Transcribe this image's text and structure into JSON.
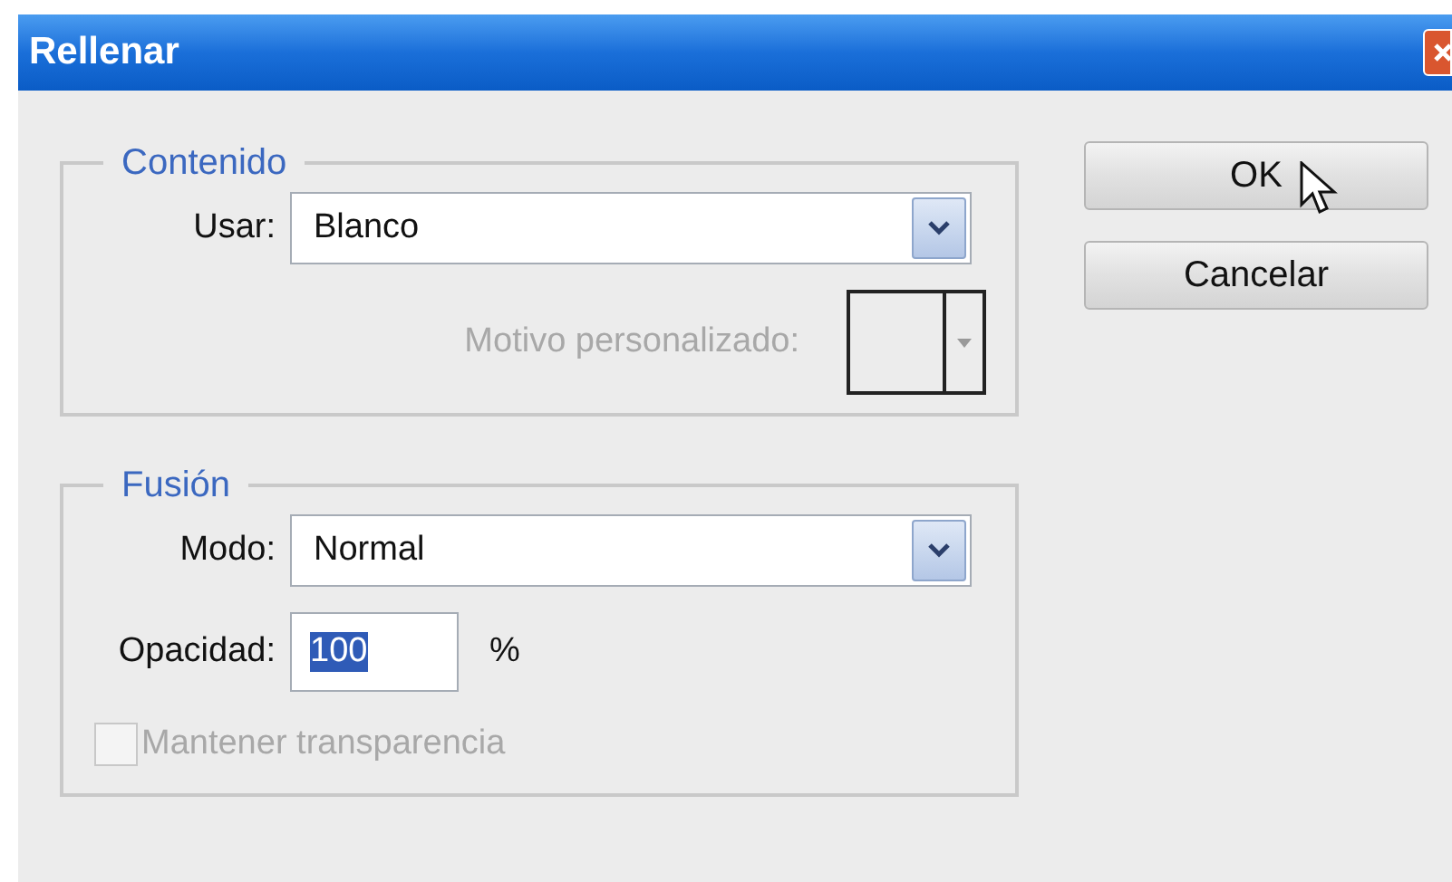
{
  "window": {
    "title": "Rellenar"
  },
  "groups": [
    {
      "title": "Contenido",
      "rows": [
        {
          "kind": "select",
          "label": "Usar:",
          "value": "Blanco",
          "disabled": false
        },
        {
          "kind": "swatch",
          "label": "Motivo personalizado:",
          "disabled": true
        }
      ]
    },
    {
      "title": "Fusión",
      "rows": [
        {
          "kind": "select",
          "label": "Modo:",
          "value": "Normal",
          "disabled": false
        },
        {
          "kind": "number",
          "label": "Opacidad:",
          "value": "100",
          "highlighted": true,
          "unit": "%"
        },
        {
          "kind": "checkbox",
          "label": "Mantener transparencia",
          "checked": false,
          "disabled": true
        }
      ]
    }
  ],
  "buttons": [
    "OK",
    "Cancelar"
  ]
}
